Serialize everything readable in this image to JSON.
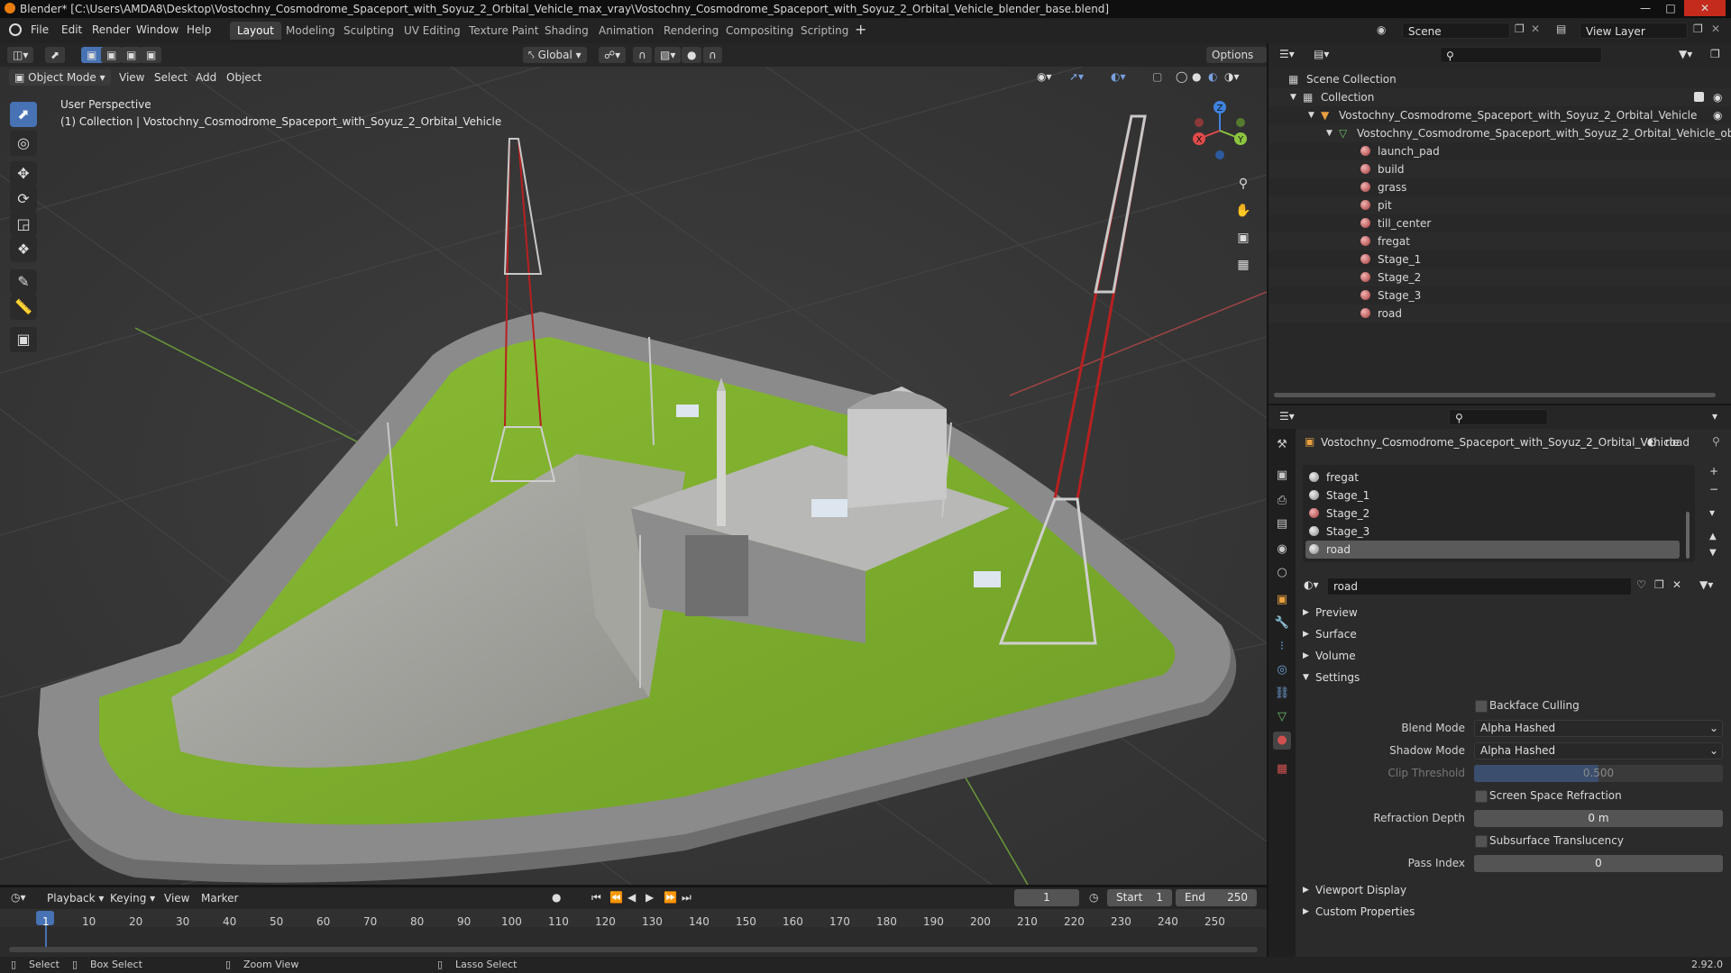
{
  "window": {
    "title": "Blender* [C:\\Users\\AMDA8\\Desktop\\Vostochny_Cosmodrome_Spaceport_with_Soyuz_2_Orbital_Vehicle_max_vray\\Vostochny_Cosmodrome_Spaceport_with_Soyuz_2_Orbital_Vehicle_blender_base.blend]"
  },
  "menu": [
    "File",
    "Edit",
    "Render",
    "Window",
    "Help"
  ],
  "workspaces": [
    "Layout",
    "Modeling",
    "Sculpting",
    "UV Editing",
    "Texture Paint",
    "Shading",
    "Animation",
    "Rendering",
    "Compositing",
    "Scripting"
  ],
  "active_workspace": "Layout",
  "topbar": {
    "scene": "Scene",
    "view_layer": "View Layer"
  },
  "viewport": {
    "orientation": "Global",
    "options": "Options",
    "mode": "Object Mode",
    "header_menu": [
      "View",
      "Select",
      "Add",
      "Object"
    ],
    "perspective": "User Perspective",
    "collection_info": "(1) Collection | Vostochny_Cosmodrome_Spaceport_with_Soyuz_2_Orbital_Vehicle",
    "gizmo": {
      "x": "X",
      "y": "Y",
      "z": "Z"
    }
  },
  "outliner": {
    "scene_collection": "Scene Collection",
    "collection": "Collection",
    "object": "Vostochny_Cosmodrome_Spaceport_with_Soyuz_2_Orbital_Vehicle",
    "mesh": "Vostochny_Cosmodrome_Spaceport_with_Soyuz_2_Orbital_Vehicle_obj",
    "materials": [
      "launch_pad",
      "build",
      "grass",
      "pit",
      "till_center",
      "fregat",
      "Stage_1",
      "Stage_2",
      "Stage_3",
      "road"
    ]
  },
  "properties": {
    "object_name": "Vostochny_Cosmodrome_Spaceport_with_Soyuz_2_Orbital_Vehicle",
    "material_name": "road",
    "slots": [
      "fregat",
      "Stage_1",
      "Stage_2",
      "Stage_3",
      "road"
    ],
    "active_slot": "road",
    "material_field": "road",
    "panels": {
      "preview": "Preview",
      "surface": "Surface",
      "volume": "Volume",
      "settings": "Settings",
      "viewport_display": "Viewport Display",
      "custom_properties": "Custom Properties"
    },
    "settings": {
      "backface_culling": "Backface Culling",
      "blend_mode_label": "Blend Mode",
      "blend_mode": "Alpha Hashed",
      "shadow_mode_label": "Shadow Mode",
      "shadow_mode": "Alpha Hashed",
      "clip_threshold_label": "Clip Threshold",
      "clip_threshold": "0.500",
      "ssr_label": "Screen Space Refraction",
      "refraction_depth_label": "Refraction Depth",
      "refraction_depth": "0 m",
      "subsurface_label": "Subsurface Translucency",
      "pass_index_label": "Pass Index",
      "pass_index": "0"
    }
  },
  "timeline": {
    "menu": [
      "Playback",
      "Keying",
      "View",
      "Marker"
    ],
    "current_frame": "1",
    "start_label": "Start",
    "start": "1",
    "end_label": "End",
    "end": "250",
    "ticks": [
      "1",
      "10",
      "20",
      "30",
      "40",
      "50",
      "60",
      "70",
      "80",
      "90",
      "100",
      "110",
      "120",
      "130",
      "140",
      "150",
      "160",
      "170",
      "180",
      "190",
      "200",
      "210",
      "220",
      "230",
      "240",
      "250"
    ]
  },
  "status": {
    "select": "Select",
    "box_select": "Box Select",
    "zoom_view": "Zoom View",
    "lasso_select": "Lasso Select",
    "version": "2.92.0"
  },
  "colors": {
    "accent": "#4772b3",
    "grass": "#7fae2e",
    "tower_red": "#b82020",
    "x_axis": "#e04a4a",
    "y_axis": "#8cc63f",
    "z_axis": "#3f83e0"
  }
}
